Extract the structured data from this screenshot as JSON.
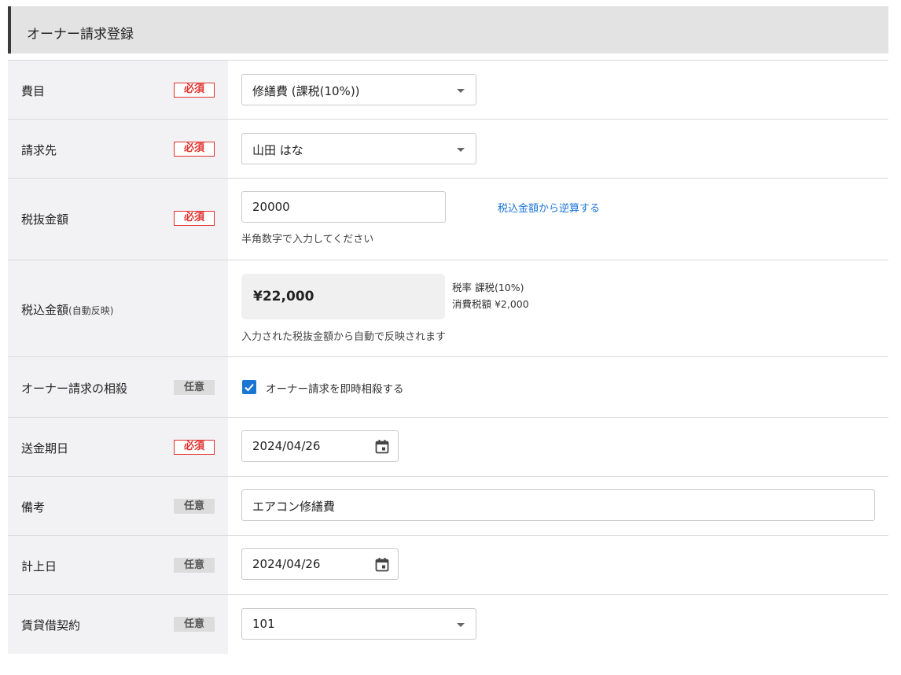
{
  "header": {
    "title": "オーナー請求登録"
  },
  "rows": {
    "himoku": {
      "label": "費目",
      "badge": "必須",
      "value": "修繕費 (課税(10%))"
    },
    "seikyusaki": {
      "label": "請求先",
      "badge": "必須",
      "value": "山田 はな"
    },
    "zeinuki": {
      "label": "税抜金額",
      "badge": "必須",
      "value": "20000",
      "hint": "半角数字で入力してください",
      "link": "税込金額から逆算する"
    },
    "zeikomi": {
      "label": "税込金額",
      "label_sub": "(自動反映)",
      "value": "¥22,000",
      "tax_rate": "税率 課税(10%)",
      "tax_amount": "消費税額 ¥2,000",
      "hint": "入力された税抜金額から自動で反映されます"
    },
    "sousai": {
      "label": "オーナー請求の相殺",
      "badge": "任意",
      "checked": true,
      "checkbox_label": "オーナー請求を即時相殺する"
    },
    "soukin": {
      "label": "送金期日",
      "badge": "必須",
      "value": "2024/04/26"
    },
    "bikou": {
      "label": "備考",
      "badge": "任意",
      "value": "エアコン修繕費"
    },
    "keijou": {
      "label": "計上日",
      "badge": "任意",
      "value": "2024/04/26"
    },
    "keiyaku": {
      "label": "賃貸借契約",
      "badge": "任意",
      "value": "101"
    }
  },
  "icons": {
    "calendar": "calendar-icon",
    "check": "checkmark-icon",
    "caret": "chevron-down-icon"
  },
  "colors": {
    "required": "#e0302b",
    "link": "#1a73d9",
    "checkbox": "#1976d2"
  }
}
